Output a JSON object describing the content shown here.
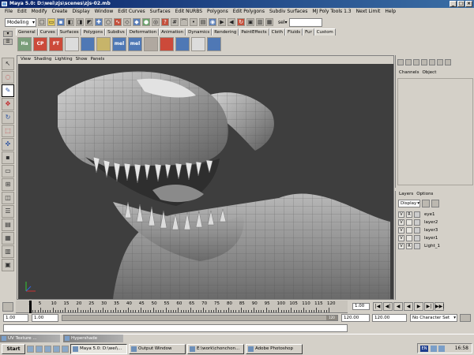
{
  "window": {
    "title": "Maya 5.0: D:\\wei\\zjs\\scenes\\zjs-02.mb"
  },
  "menubar": [
    "File",
    "Edit",
    "Modify",
    "Create",
    "Display",
    "Window",
    "Edit Curves",
    "Surfaces",
    "Edit NURBS",
    "Polygons",
    "Edit Polygons",
    "Subdiv Surfaces",
    "MJ Poly Tools 1.3",
    "Next Limit",
    "Help"
  ],
  "statusline": {
    "mode": "Modeling",
    "sel_label": "sel▾"
  },
  "shelf": {
    "tabs": [
      "General",
      "Curves",
      "Surfaces",
      "Polygons",
      "Subdivs",
      "Deformation",
      "Animation",
      "Dynamics",
      "Rendering",
      "PaintEffects",
      "Cloth",
      "Fluids",
      "Fur",
      "Custom"
    ],
    "active_tab": "Custom",
    "items": [
      {
        "label": "Ha",
        "icon": "hair-icon"
      },
      {
        "label": "CP",
        "icon": "cp-icon"
      },
      {
        "label": "FT",
        "icon": "ft-icon"
      },
      {
        "label": "",
        "icon": "script-icon-1"
      },
      {
        "label": "",
        "icon": "script-icon-2"
      },
      {
        "label": "",
        "icon": "script-icon-3"
      },
      {
        "label": "mel",
        "icon": "mel-icon-1"
      },
      {
        "label": "mel",
        "icon": "mel-icon-2"
      },
      {
        "label": "",
        "icon": "script-icon-4"
      },
      {
        "label": "",
        "icon": "script-icon-5"
      },
      {
        "label": "",
        "icon": "script-icon-6"
      },
      {
        "label": "",
        "icon": "script-icon-7"
      },
      {
        "label": "",
        "icon": "script-icon-8"
      }
    ]
  },
  "viewport": {
    "menus": [
      "View",
      "Shading",
      "Lighting",
      "Show",
      "Panels"
    ]
  },
  "channel_box": {
    "menus": [
      "Channels",
      "Object"
    ]
  },
  "layers": {
    "menus": [
      "Layers",
      "Options"
    ],
    "display_option": "Display",
    "list": [
      {
        "v": "V",
        "r": "R",
        "name": "eye1"
      },
      {
        "v": "V",
        "r": "",
        "name": "layer2"
      },
      {
        "v": "V",
        "r": "",
        "name": "layer3"
      },
      {
        "v": "V",
        "r": "",
        "name": "layer1"
      },
      {
        "v": "V",
        "r": "R",
        "name": "Light_1"
      }
    ]
  },
  "timeline": {
    "ticks": [
      "1",
      "5",
      "10",
      "15",
      "20",
      "25",
      "30",
      "35",
      "40",
      "45",
      "50",
      "55",
      "60",
      "65",
      "70",
      "75",
      "80",
      "85",
      "90",
      "95",
      "100",
      "105",
      "110",
      "115",
      "120"
    ],
    "current_frame": "1.00",
    "playback": [
      "|◀",
      "◀|",
      "◀",
      "◀",
      "▶",
      "▶|",
      "▶▶|"
    ]
  },
  "range": {
    "start": "1.00",
    "playback_start": "1.00",
    "playback_end": "120.00",
    "end": "120.00",
    "knob_label": "120",
    "character_set": "No Character Set"
  },
  "taskbar": {
    "minimized": [
      "UV Texture ...",
      "Hypershade"
    ],
    "start": "Start",
    "tasks": [
      "Maya 5.0: D:\\wei\\...",
      "Output Window",
      "E:\\work\\chonchon...",
      "Adobe Photoshop"
    ],
    "active_task": 0,
    "tray_lang": "EN",
    "clock": "16:58"
  },
  "colors": {
    "viewport_bg": "#3e3e3e",
    "title_bar": "#0a246a",
    "chrome": "#d4d0c8"
  }
}
